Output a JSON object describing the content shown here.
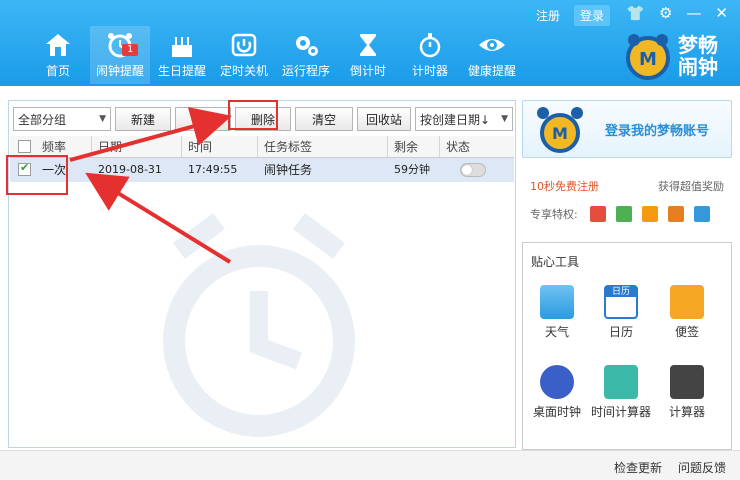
{
  "header": {
    "register": "注册",
    "login": "登录",
    "brand_line1": "梦畅",
    "brand_line2": "闹钟",
    "nav": [
      {
        "label": "首页",
        "icon": "home-icon"
      },
      {
        "label": "闹钟提醒",
        "icon": "alarm-clock-icon",
        "badge": "1",
        "active": true
      },
      {
        "label": "生日提醒",
        "icon": "birthday-cake-icon"
      },
      {
        "label": "定时关机",
        "icon": "power-icon"
      },
      {
        "label": "运行程序",
        "icon": "gears-icon"
      },
      {
        "label": "倒计时",
        "icon": "hourglass-icon"
      },
      {
        "label": "计时器",
        "icon": "stopwatch-icon"
      },
      {
        "label": "健康提醒",
        "icon": "eye-icon"
      }
    ]
  },
  "toolbar": {
    "group_select": "全部分组",
    "new": "新建",
    "edit": "修改",
    "delete": "删除",
    "clear": "清空",
    "recycle": "回收站",
    "sort_select": "按创建日期↓"
  },
  "table": {
    "columns": [
      "频率",
      "日期",
      "时间",
      "任务标签",
      "剩余",
      "状态"
    ],
    "rows": [
      {
        "checked": true,
        "frequency": "一次",
        "date": "2019-08-31",
        "time": "17:49:55",
        "label": "闹钟任务",
        "remaining": "59分钟",
        "status_on": false
      }
    ]
  },
  "side": {
    "login_card": "登录我的梦畅账号",
    "register_promo": "10秒免费注册",
    "reward": "获得超值奖励",
    "privileges": "专享特权:",
    "tools_title": "贴心工具",
    "tools": [
      {
        "label": "天气",
        "icon": "weather-icon"
      },
      {
        "label": "日历",
        "icon": "calendar-icon"
      },
      {
        "label": "便签",
        "icon": "note-icon"
      },
      {
        "label": "桌面时钟",
        "icon": "desktop-clock-icon"
      },
      {
        "label": "时间计算器",
        "icon": "time-calculator-icon"
      },
      {
        "label": "计算器",
        "icon": "calculator-icon"
      }
    ],
    "calendar_header": "日历"
  },
  "footer": {
    "check_update": "检查更新",
    "feedback": "问题反馈"
  },
  "colors": {
    "header_blue": "#1b9be8",
    "annotation_red": "#e53030",
    "row_highlight": "#dde7f5"
  }
}
